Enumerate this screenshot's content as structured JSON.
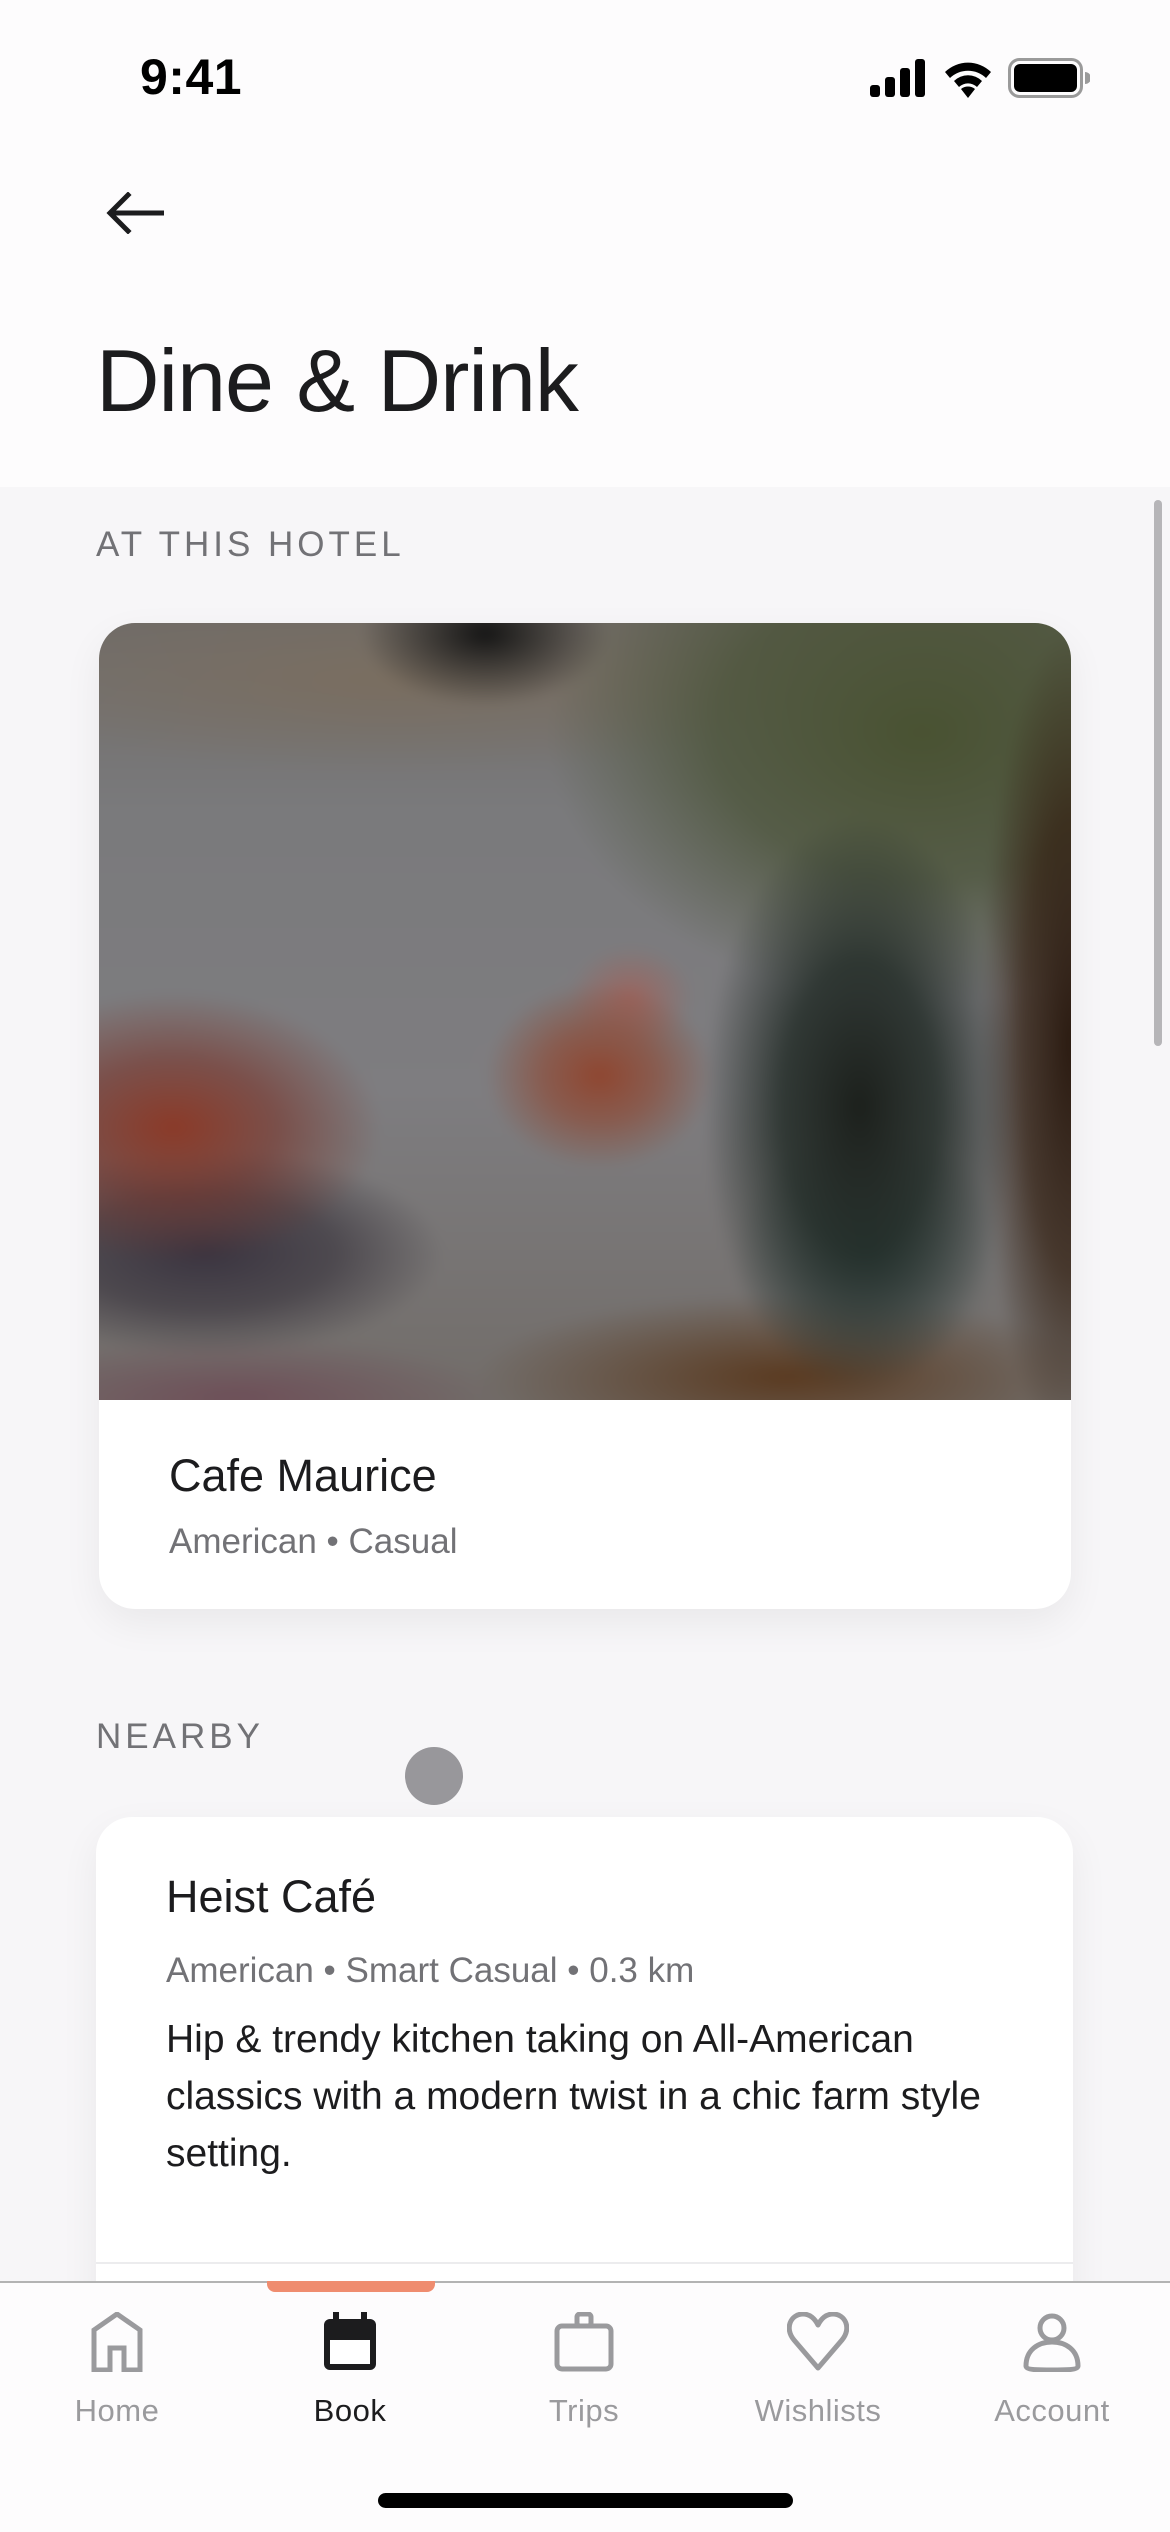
{
  "status_bar": {
    "time": "9:41",
    "icons": [
      "cellular-signal-icon",
      "wifi-icon",
      "battery-icon"
    ]
  },
  "header": {
    "back_icon": "arrow-left-icon",
    "title": "Dine & Drink"
  },
  "sections": [
    {
      "label": "AT THIS HOTEL",
      "restaurants": [
        {
          "name": "Cafe Maurice",
          "meta": "American • Casual",
          "image": "blurred-restaurant-photo"
        }
      ]
    },
    {
      "label": "NEARBY",
      "restaurants": [
        {
          "name": "Heist Café",
          "meta": "American • Smart Casual • 0.3 km",
          "description": "Hip & trendy kitchen taking on All-American classics with a modern twist in a chic farm style setting."
        }
      ]
    }
  ],
  "tabbar": {
    "active_tab": "Book",
    "accent_color": "#ef8c6f",
    "tabs": [
      {
        "label": "Home",
        "icon": "home-icon"
      },
      {
        "label": "Book",
        "icon": "calendar-icon"
      },
      {
        "label": "Trips",
        "icon": "suitcase-icon"
      },
      {
        "label": "Wishlists",
        "icon": "heart-icon"
      },
      {
        "label": "Account",
        "icon": "person-icon"
      }
    ]
  }
}
